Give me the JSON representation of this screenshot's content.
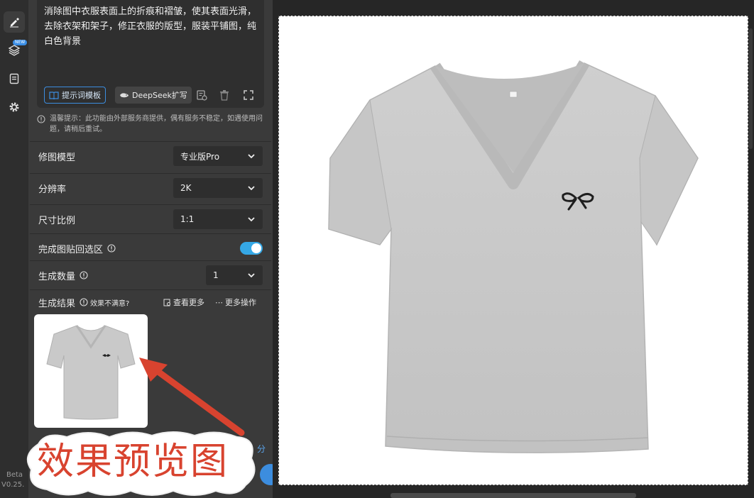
{
  "rail": {
    "items": [
      {
        "icon": "edit-icon"
      },
      {
        "icon": "layers-icon",
        "badge": "NEW"
      },
      {
        "icon": "document-icon"
      },
      {
        "icon": "gear-icon"
      }
    ],
    "version_line1": "Beta",
    "version_line2": "V0.25."
  },
  "prompt": {
    "text": "消除图中衣服表面上的折痕和褶皱，使其表面光滑，去除衣架和架子，修正衣服的版型，服装平铺图，纯白色背景",
    "template_button": "提示词模板",
    "deepseek_button": "DeepSeek扩写"
  },
  "notice": "温馨提示：此功能由外部服务商提供，偶有服务不稳定，如遇使用问题，请稍后重试。",
  "settings": {
    "model_label": "修图模型",
    "model_value": "专业版Pro",
    "resolution_label": "分辨率",
    "resolution_value": "2K",
    "ratio_label": "尺寸比例",
    "ratio_value": "1:1",
    "paste_back_label": "完成图贴回选区",
    "paste_back_on": true,
    "count_label": "生成数量",
    "count_value": "1"
  },
  "results": {
    "title": "生成结果",
    "unsatisfied": "效果不满意?",
    "view_more": "查看更多",
    "more_actions": "更多操作",
    "side_text": "分"
  },
  "caption": "效果预览图",
  "colors": {
    "accent": "#35a8e6",
    "caption_red": "#d8432f",
    "panel_bg": "#3a3a3a"
  }
}
